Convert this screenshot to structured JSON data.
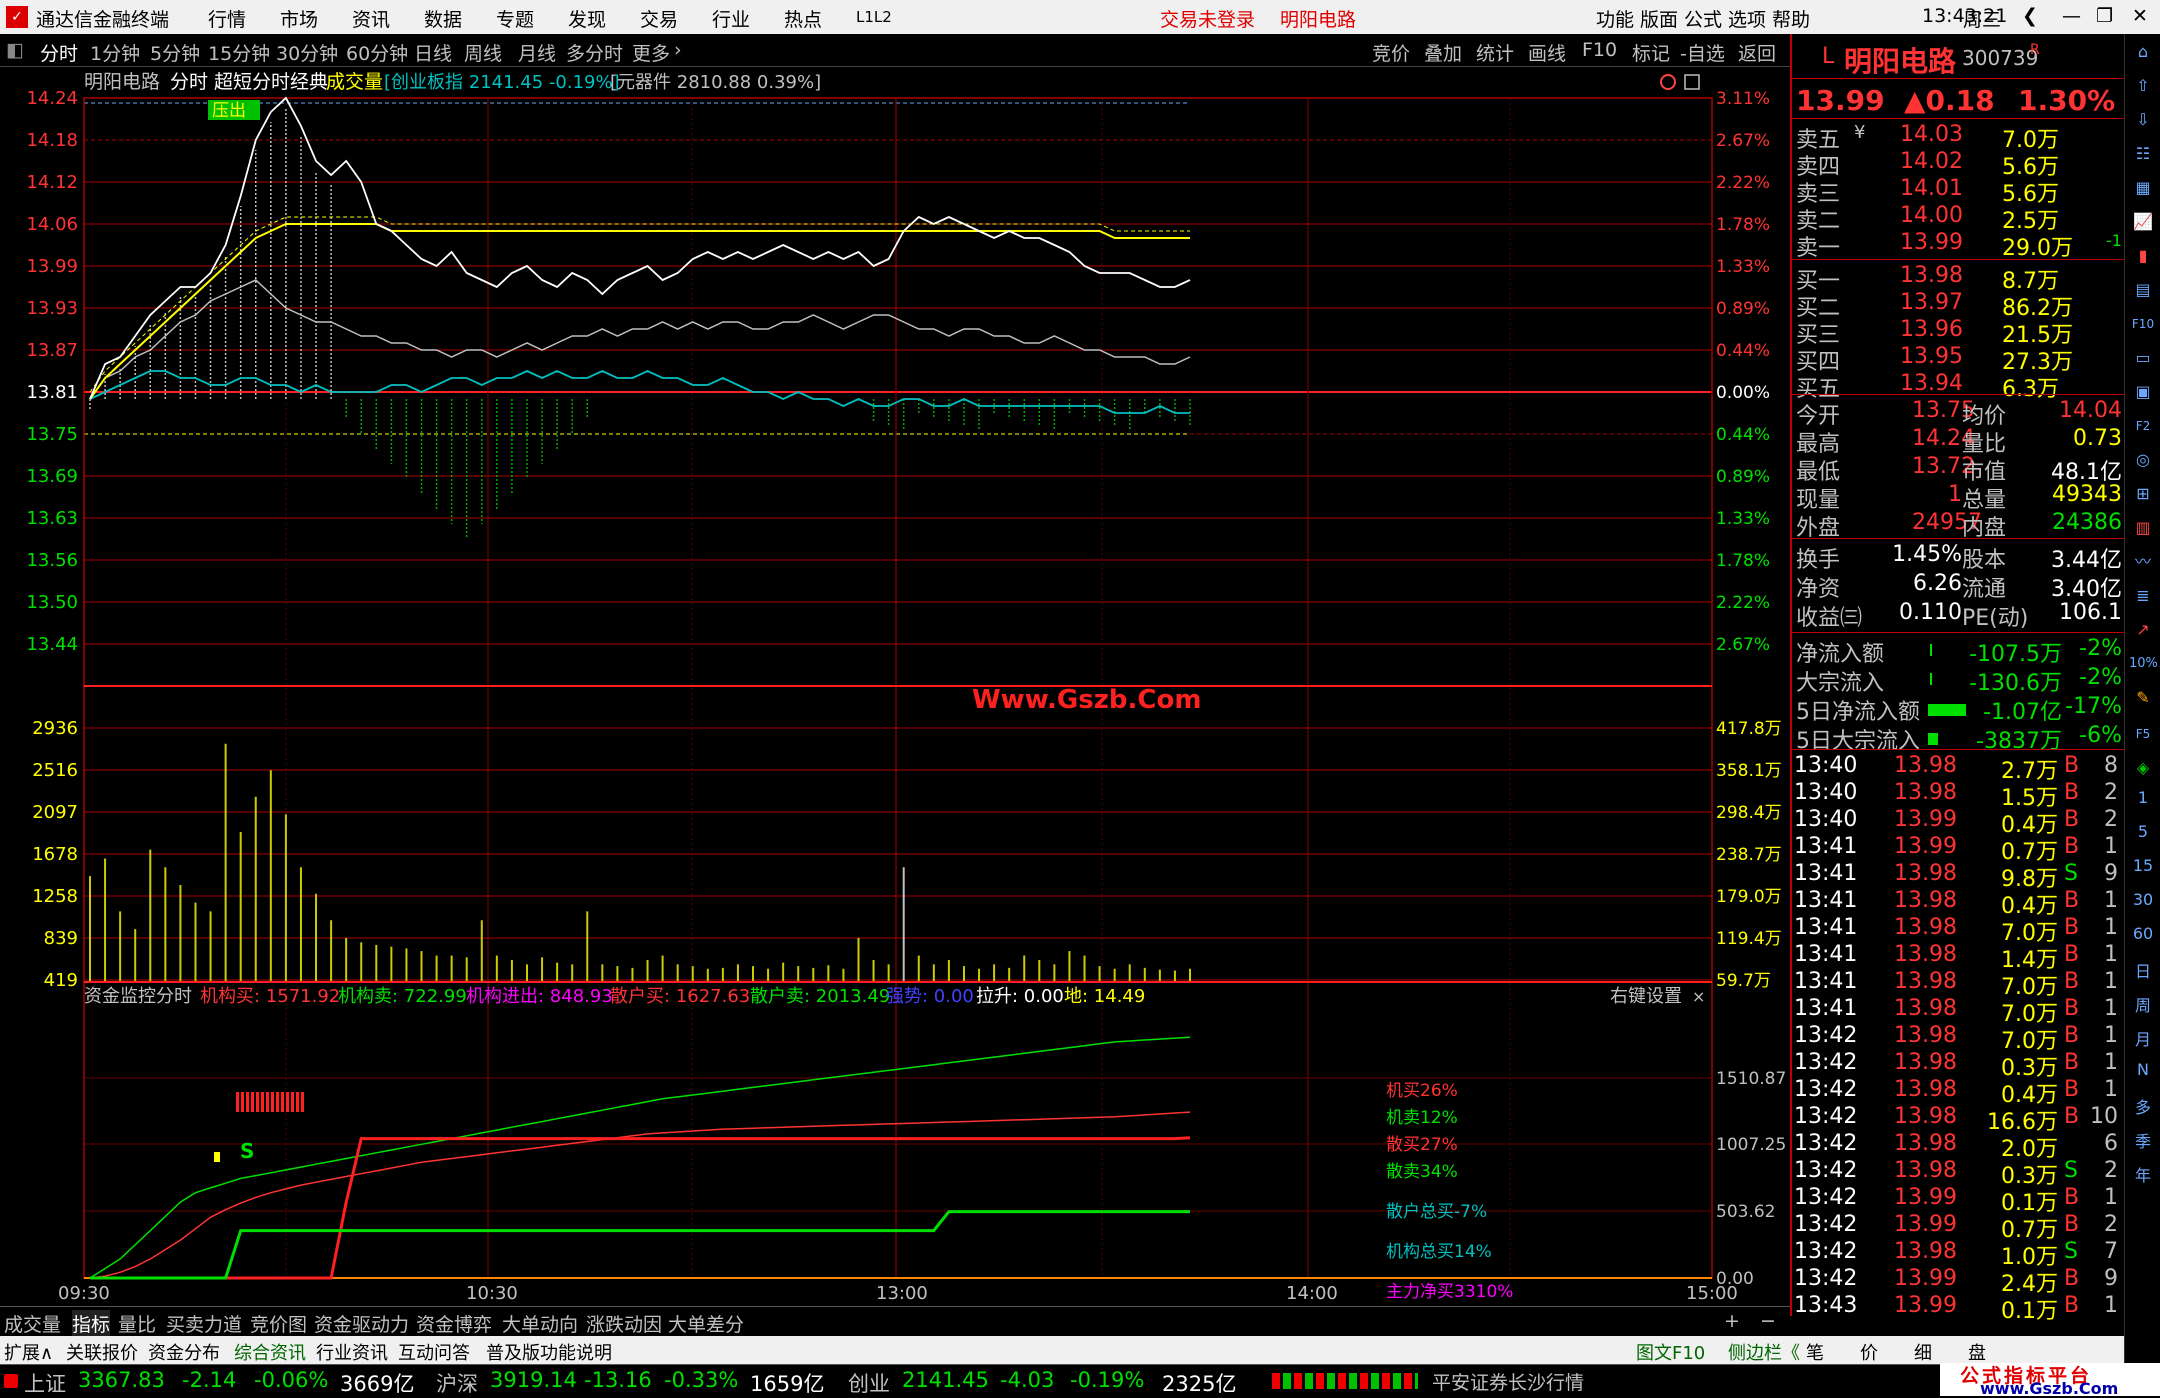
{
  "app": {
    "title": "通达信金融终端",
    "menu": [
      "行情",
      "市场",
      "资讯",
      "数据",
      "专题",
      "发现",
      "交易",
      "行业",
      "热点",
      "L1L2"
    ],
    "login_status": "交易未登录",
    "stock_name_title": "明阳电路",
    "right_menu": [
      "功能",
      "版面",
      "公式",
      "选项",
      "帮助"
    ],
    "clock": "13:43:21",
    "weekday": "周三"
  },
  "periods": [
    "分时",
    "1分钟",
    "5分钟",
    "15分钟",
    "30分钟",
    "60分钟",
    "日线",
    "周线",
    "月线",
    "多分时",
    "更多"
  ],
  "toolbar": [
    "竞价",
    "叠加",
    "统计",
    "画线",
    "F10",
    "标记",
    "-自选",
    "返回"
  ],
  "chart": {
    "header": {
      "name": "明阳电路",
      "mode": "分时 超短分时经典",
      "vol": "成交量",
      "index": "[创业板指 2141.45 -0.19%]",
      "sector": "[元器件 2810.88 0.39%]"
    },
    "price_ticks": [
      "14.24",
      "14.18",
      "14.12",
      "14.06",
      "13.99",
      "13.93",
      "13.87",
      "13.81",
      "13.75",
      "13.69",
      "13.63",
      "13.56",
      "13.50",
      "13.44"
    ],
    "pct_ticks": [
      "3.11%",
      "2.67%",
      "2.22%",
      "1.78%",
      "1.33%",
      "0.89%",
      "0.44%",
      "0.00%",
      "0.44%",
      "0.89%",
      "1.33%",
      "1.78%",
      "2.22%",
      "2.67%"
    ],
    "vol_ticks": [
      "2936",
      "2516",
      "2097",
      "1678",
      "1258",
      "839",
      "419"
    ],
    "vol_right_ticks": [
      "417.8万",
      "358.1万",
      "298.4万",
      "238.7万",
      "179.0万",
      "119.4万",
      "59.7万"
    ],
    "signal_label": "压出",
    "watermark": "Www.Gszb.Com",
    "price_line": [
      13.81,
      13.86,
      13.87,
      13.9,
      13.93,
      13.95,
      13.97,
      13.97,
      13.99,
      14.03,
      14.1,
      14.18,
      14.22,
      14.24,
      14.2,
      14.15,
      14.13,
      14.15,
      14.12,
      14.06,
      14.05,
      14.03,
      14.01,
      14.0,
      14.02,
      13.99,
      13.98,
      13.97,
      13.99,
      14.0,
      13.98,
      13.97,
      13.99,
      13.98,
      13.96,
      13.98,
      13.99,
      14.0,
      13.98,
      13.99,
      14.01,
      14.02,
      14.01,
      14.02,
      14.01,
      14.02,
      14.03,
      14.02,
      14.01,
      14.02,
      14.01,
      14.02,
      14.0,
      14.01,
      14.05,
      14.07,
      14.06,
      14.07,
      14.06,
      14.05,
      14.04,
      14.05,
      14.04,
      14.04,
      14.03,
      14.02,
      14.0,
      13.99,
      13.99,
      13.99,
      13.98,
      13.97,
      13.97,
      13.98
    ],
    "avg_line": [
      13.81,
      13.84,
      13.86,
      13.88,
      13.9,
      13.92,
      13.94,
      13.96,
      13.98,
      14.0,
      14.02,
      14.04,
      14.05,
      14.06,
      14.06,
      14.06,
      14.06,
      14.06,
      14.06,
      14.06,
      14.05,
      14.05,
      14.05,
      14.05,
      14.05,
      14.05,
      14.05,
      14.05,
      14.05,
      14.05,
      14.05,
      14.05,
      14.05,
      14.05,
      14.05,
      14.05,
      14.05,
      14.05,
      14.05,
      14.05,
      14.05,
      14.05,
      14.05,
      14.05,
      14.05,
      14.05,
      14.05,
      14.05,
      14.05,
      14.05,
      14.05,
      14.05,
      14.05,
      14.05,
      14.05,
      14.05,
      14.05,
      14.05,
      14.05,
      14.05,
      14.05,
      14.05,
      14.05,
      14.05,
      14.05,
      14.05,
      14.05,
      14.05,
      14.04,
      14.04,
      14.04,
      14.04,
      14.04,
      14.04
    ],
    "idx1_line": [
      13.81,
      13.84,
      13.85,
      13.87,
      13.88,
      13.9,
      13.92,
      13.93,
      13.95,
      13.96,
      13.97,
      13.98,
      13.96,
      13.94,
      13.93,
      13.92,
      13.92,
      13.91,
      13.9,
      13.9,
      13.89,
      13.89,
      13.88,
      13.88,
      13.87,
      13.88,
      13.88,
      13.87,
      13.88,
      13.89,
      13.88,
      13.89,
      13.9,
      13.9,
      13.91,
      13.9,
      13.91,
      13.91,
      13.92,
      13.91,
      13.92,
      13.91,
      13.92,
      13.92,
      13.91,
      13.91,
      13.92,
      13.92,
      13.93,
      13.92,
      13.91,
      13.92,
      13.93,
      13.93,
      13.92,
      13.91,
      13.91,
      13.9,
      13.91,
      13.91,
      13.9,
      13.9,
      13.89,
      13.89,
      13.9,
      13.89,
      13.88,
      13.88,
      13.87,
      13.87,
      13.87,
      13.86,
      13.86,
      13.87
    ],
    "idx2_line": [
      13.81,
      13.82,
      13.83,
      13.84,
      13.85,
      13.85,
      13.84,
      13.84,
      13.83,
      13.83,
      13.84,
      13.84,
      13.83,
      13.83,
      13.82,
      13.83,
      13.82,
      13.82,
      13.82,
      13.82,
      13.83,
      13.83,
      13.82,
      13.83,
      13.84,
      13.84,
      13.83,
      13.84,
      13.84,
      13.85,
      13.84,
      13.85,
      13.84,
      13.84,
      13.85,
      13.84,
      13.84,
      13.85,
      13.84,
      13.84,
      13.83,
      13.83,
      13.84,
      13.83,
      13.82,
      13.82,
      13.81,
      13.82,
      13.81,
      13.81,
      13.8,
      13.81,
      13.8,
      13.8,
      13.81,
      13.81,
      13.8,
      13.8,
      13.81,
      13.8,
      13.8,
      13.8,
      13.8,
      13.8,
      13.8,
      13.8,
      13.8,
      13.8,
      13.79,
      13.79,
      13.79,
      13.8,
      13.79,
      13.79
    ],
    "volume": [
      1200,
      1400,
      800,
      600,
      1500,
      1300,
      1100,
      900,
      800,
      2700,
      1700,
      2100,
      2400,
      1900,
      1300,
      1000,
      700,
      500,
      450,
      420,
      400,
      380,
      350,
      300,
      300,
      280,
      700,
      300,
      250,
      200,
      280,
      220,
      200,
      800,
      200,
      180,
      160,
      250,
      300,
      200,
      180,
      150,
      160,
      200,
      180,
      150,
      220,
      180,
      160,
      190,
      150,
      500,
      250,
      200,
      1300,
      300,
      200,
      250,
      180,
      150,
      200,
      160,
      300,
      250,
      200,
      350,
      300,
      180,
      150,
      200,
      160,
      140,
      130,
      150
    ],
    "fund": {
      "header": {
        "title": "资金监控分时",
        "inst_buy": "机构买: 1571.92",
        "inst_sell": "机构卖: 722.99",
        "inst_net": "机构进出: 848.93",
        "retail_buy": "散户买: 1627.63",
        "retail_sell": "散户卖: 2013.49",
        "strong": "强势: 0.00",
        "pull": "拉升: 0.00",
        "ground": "地: 14.49"
      },
      "settings": "右键设置",
      "right_ticks": [
        "1510.87",
        "1007.25",
        "503.62",
        "0.00"
      ],
      "legend": [
        "机买26%",
        "机卖12%",
        "散买27%",
        "散卖34%",
        "散户总买-7%",
        "机构总买14%",
        "主力净买3310%"
      ],
      "signal_s": "S",
      "inst_buy_line": [
        0,
        20,
        60,
        120,
        200,
        300,
        400,
        520,
        640,
        720,
        790,
        850,
        900,
        940,
        980,
        1010,
        1040,
        1070,
        1100,
        1130,
        1160,
        1190,
        1220,
        1240,
        1260,
        1280,
        1300,
        1320,
        1340,
        1360,
        1380,
        1400,
        1420,
        1440,
        1460,
        1480,
        1500,
        1520,
        1530,
        1540,
        1550,
        1560,
        1570,
        1575,
        1580,
        1585,
        1590,
        1595,
        1600,
        1605,
        1610,
        1615,
        1620,
        1625,
        1630,
        1635,
        1640,
        1645,
        1650,
        1655,
        1660,
        1665,
        1670,
        1675,
        1680,
        1685,
        1690,
        1695,
        1700,
        1710,
        1720,
        1730,
        1740,
        1750
      ],
      "inst_sell_line": [
        0,
        100,
        200,
        350,
        500,
        650,
        800,
        900,
        950,
        1000,
        1050,
        1080,
        1110,
        1140,
        1170,
        1200,
        1230,
        1260,
        1290,
        1320,
        1350,
        1380,
        1410,
        1440,
        1470,
        1500,
        1530,
        1560,
        1590,
        1620,
        1650,
        1680,
        1710,
        1740,
        1770,
        1800,
        1830,
        1860,
        1890,
        1910,
        1930,
        1950,
        1970,
        1990,
        2010,
        2030,
        2050,
        2070,
        2090,
        2110,
        2130,
        2150,
        2170,
        2190,
        2210,
        2230,
        2250,
        2270,
        2290,
        2310,
        2330,
        2350,
        2370,
        2390,
        2410,
        2430,
        2450,
        2470,
        2490,
        2500,
        2510,
        2520,
        2530,
        2540
      ],
      "retail_buy_line": [
        0,
        0,
        0,
        0,
        0,
        0,
        0,
        0,
        0,
        0,
        0,
        0,
        0,
        0,
        0,
        0,
        0,
        800,
        1470,
        1470,
        1470,
        1470,
        1470,
        1470,
        1470,
        1470,
        1470,
        1470,
        1470,
        1470,
        1470,
        1470,
        1470,
        1470,
        1470,
        1470,
        1470,
        1470,
        1470,
        1470,
        1470,
        1470,
        1470,
        1470,
        1470,
        1470,
        1470,
        1470,
        1470,
        1470,
        1470,
        1470,
        1470,
        1470,
        1470,
        1470,
        1470,
        1470,
        1470,
        1470,
        1470,
        1470,
        1470,
        1470,
        1470,
        1470,
        1470,
        1470,
        1470,
        1470,
        1470,
        1470,
        1470,
        1480
      ],
      "retail_sell_line": [
        0,
        0,
        0,
        0,
        0,
        0,
        0,
        0,
        0,
        0,
        500,
        500,
        500,
        500,
        500,
        500,
        500,
        500,
        500,
        500,
        500,
        500,
        500,
        500,
        500,
        500,
        500,
        500,
        500,
        500,
        500,
        500,
        500,
        500,
        500,
        500,
        500,
        500,
        500,
        500,
        500,
        500,
        500,
        500,
        500,
        500,
        500,
        500,
        500,
        500,
        500,
        500,
        500,
        500,
        500,
        500,
        500,
        700,
        700,
        700,
        700,
        700,
        700,
        700,
        700,
        700,
        700,
        700,
        700,
        700,
        700,
        700,
        700,
        700
      ]
    },
    "time_ticks": [
      "09:30",
      "10:30",
      "13:00",
      "14:00",
      "15:00"
    ]
  },
  "quote": {
    "name": "明阳电路",
    "code": "300739",
    "flag": "R",
    "prefix": "L",
    "price": "13.99",
    "change": "▲0.18",
    "pct": "1.30%",
    "asks": [
      [
        "卖五",
        "14.03",
        "7.0万"
      ],
      [
        "卖四",
        "14.02",
        "5.6万"
      ],
      [
        "卖三",
        "14.01",
        "5.6万"
      ],
      [
        "卖二",
        "14.00",
        "2.5万"
      ],
      [
        "卖一",
        "13.99",
        "29.0万"
      ]
    ],
    "ask_extra": "-1",
    "bids": [
      [
        "买一",
        "13.98",
        "8.7万"
      ],
      [
        "买二",
        "13.97",
        "86.2万"
      ],
      [
        "买三",
        "13.96",
        "21.5万"
      ],
      [
        "买四",
        "13.95",
        "27.3万"
      ],
      [
        "买五",
        "13.94",
        "6.3万"
      ]
    ],
    "stats": [
      [
        "今开",
        "13.75",
        "均价",
        "14.04"
      ],
      [
        "最高",
        "14.24",
        "量比",
        "0.73"
      ],
      [
        "最低",
        "13.72",
        "市值",
        "48.1亿"
      ],
      [
        "现量",
        "1",
        "总量",
        "49343"
      ],
      [
        "外盘",
        "24957",
        "内盘",
        "24386"
      ]
    ],
    "stats2": [
      [
        "换手",
        "1.45%",
        "股本",
        "3.44亿"
      ],
      [
        "净资",
        "6.26",
        "流通",
        "3.40亿"
      ],
      [
        "收益㈢",
        "0.110",
        "PE(动)",
        "106.1"
      ]
    ],
    "flows": [
      [
        "净流入额",
        "-107.5万",
        "-2%"
      ],
      [
        "大宗流入",
        "-130.6万",
        "-2%"
      ],
      [
        "5日净流入额",
        "-1.07亿",
        "-17%"
      ],
      [
        "5日大宗流入",
        "-3837万",
        "-6%"
      ]
    ],
    "ticks": [
      [
        "13:40",
        "13.98",
        "2.7万",
        "B",
        "8"
      ],
      [
        "13:40",
        "13.98",
        "1.5万",
        "B",
        "2"
      ],
      [
        "13:40",
        "13.99",
        "0.4万",
        "B",
        "2"
      ],
      [
        "13:41",
        "13.99",
        "0.7万",
        "B",
        "1"
      ],
      [
        "13:41",
        "13.98",
        "9.8万",
        "S",
        "9"
      ],
      [
        "13:41",
        "13.98",
        "0.4万",
        "B",
        "1"
      ],
      [
        "13:41",
        "13.98",
        "7.0万",
        "B",
        "1"
      ],
      [
        "13:41",
        "13.98",
        "1.4万",
        "B",
        "1"
      ],
      [
        "13:41",
        "13.98",
        "7.0万",
        "B",
        "1"
      ],
      [
        "13:41",
        "13.98",
        "7.0万",
        "B",
        "1"
      ],
      [
        "13:42",
        "13.98",
        "7.0万",
        "B",
        "1"
      ],
      [
        "13:42",
        "13.98",
        "0.3万",
        "B",
        "1"
      ],
      [
        "13:42",
        "13.98",
        "0.4万",
        "B",
        "1"
      ],
      [
        "13:42",
        "13.98",
        "16.6万",
        "B",
        "10"
      ],
      [
        "13:42",
        "13.98",
        "2.0万",
        "",
        "6"
      ],
      [
        "13:42",
        "13.98",
        "0.3万",
        "S",
        "2"
      ],
      [
        "13:42",
        "13.99",
        "0.1万",
        "B",
        "1"
      ],
      [
        "13:42",
        "13.99",
        "0.7万",
        "B",
        "2"
      ],
      [
        "13:42",
        "13.98",
        "1.0万",
        "S",
        "7"
      ],
      [
        "13:42",
        "13.99",
        "2.4万",
        "B",
        "9"
      ],
      [
        "13:43",
        "13.99",
        "0.1万",
        "B",
        "1"
      ]
    ]
  },
  "sidebar_icons": [
    "1",
    "5",
    "15",
    "30",
    "60",
    "日",
    "周",
    "月",
    "N",
    "多",
    "季",
    "年"
  ],
  "tabs": [
    "成交量",
    "指标",
    "量比",
    "买卖力道",
    "竞价图",
    "资金驱动力",
    "资金博弈",
    "大单动向",
    "涨跌动因",
    "大单差分"
  ],
  "ext": {
    "left": [
      "扩展∧",
      "关联报价",
      "资金分布",
      "综合资讯",
      "行业资讯",
      "互动问答",
      "普及版功能说明"
    ],
    "right": [
      "图文F10",
      "侧边栏《",
      "笔",
      "价",
      "细",
      "盘"
    ]
  },
  "status": {
    "sh": {
      "label": "上证",
      "val": "3367.83",
      "chg": "-2.14",
      "pct": "-0.06%",
      "amt": "3669亿"
    },
    "sz": {
      "label": "沪深",
      "val": "3919.14",
      "chg": "-13.16",
      "pct": "-0.33%",
      "amt": "1659亿"
    },
    "cy": {
      "label": "创业",
      "val": "2141.45",
      "chg": "-4.03",
      "pct": "-0.19%",
      "amt": "2325亿"
    },
    "broker": "平安证券长沙行情",
    "brand_line1": "公式指标平台",
    "brand_line2": "www.Gszb.Com"
  },
  "colors": {
    "up": "#ff3333",
    "down": "#00e000",
    "grid": "#8b0000",
    "yellow": "#ffff00",
    "cyan": "#00c0c0",
    "white": "#ffffff"
  }
}
